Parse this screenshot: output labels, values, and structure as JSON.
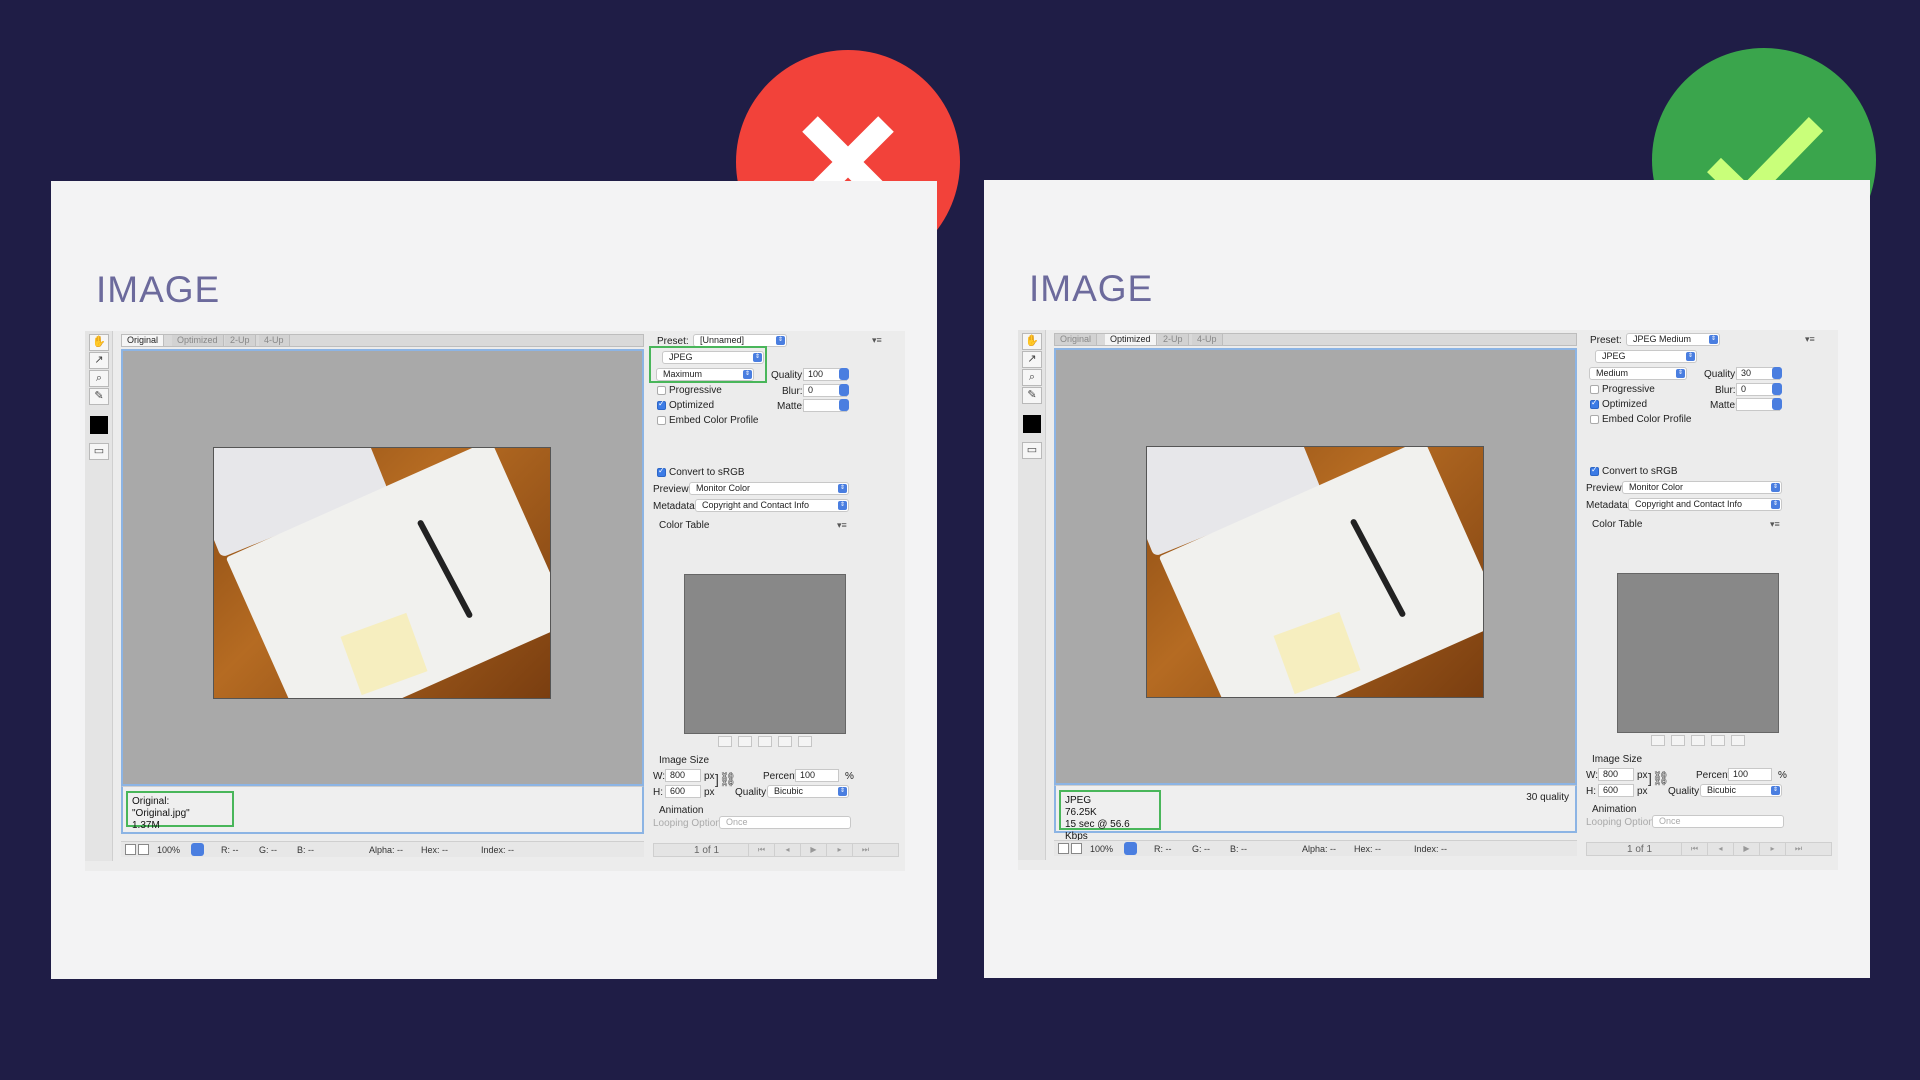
{
  "colors": {
    "background": "#1f1d46",
    "card": "#f3f3f4",
    "bad": "#f2423a",
    "good": "#3aa54c",
    "highlight": "#49b65a"
  },
  "cards": [
    {
      "heading": "IMAGE",
      "badge_icon": "cross-icon",
      "dialog": {
        "tabs": [
          "Original",
          "Optimized",
          "2-Up",
          "4-Up"
        ],
        "active_tab": "Original",
        "info_lines": [
          "Original: \"Original.jpg\"",
          "1.37M"
        ],
        "quality_note": "",
        "status": {
          "zoom": "100%",
          "r": "R: --",
          "g": "G: --",
          "b": "B: --",
          "alpha": "Alpha: --",
          "hex": "Hex: --",
          "index": "Index: --"
        },
        "preset_label": "Preset:",
        "preset_value": "[Unnamed]",
        "format": "JPEG",
        "quality_level": "Maximum",
        "quality_label": "Quality:",
        "quality_value": "100",
        "blur_label": "Blur:",
        "blur_value": "0",
        "matte_label": "Matte:",
        "matte_value": "",
        "progressive": "Progressive",
        "progressive_checked": false,
        "optimized": "Optimized",
        "optimized_checked": true,
        "embed": "Embed Color Profile",
        "embed_checked": false,
        "srgb": "Convert to sRGB",
        "srgb_checked": true,
        "preview_label": "Preview:",
        "preview_value": "Monitor Color",
        "metadata_label": "Metadata:",
        "metadata_value": "Copyright and Contact Info",
        "color_table": "Color Table",
        "image_size": "Image Size",
        "w_label": "W:",
        "w_value": "800",
        "h_label": "H:",
        "h_value": "600",
        "px": "px",
        "percent_label": "Percent:",
        "percent_value": "100",
        "percent_unit": "%",
        "resample_label": "Quality:",
        "resample_value": "Bicubic",
        "animation": "Animation",
        "looping_label": "Looping Options:",
        "looping_value": "Once",
        "frame": "1 of 1"
      }
    },
    {
      "heading": "IMAGE",
      "badge_icon": "checkmark-icon",
      "dialog": {
        "tabs": [
          "Original",
          "Optimized",
          "2-Up",
          "4-Up"
        ],
        "active_tab": "Optimized",
        "info_lines": [
          "JPEG",
          "76.25K",
          "15 sec @ 56.6 Kbps"
        ],
        "quality_note": "30 quality",
        "status": {
          "zoom": "100%",
          "r": "R: --",
          "g": "G: --",
          "b": "B: --",
          "alpha": "Alpha: --",
          "hex": "Hex: --",
          "index": "Index: --"
        },
        "preset_label": "Preset:",
        "preset_value": "JPEG Medium",
        "format": "JPEG",
        "quality_level": "Medium",
        "quality_label": "Quality:",
        "quality_value": "30",
        "blur_label": "Blur:",
        "blur_value": "0",
        "matte_label": "Matte:",
        "matte_value": "",
        "progressive": "Progressive",
        "progressive_checked": false,
        "optimized": "Optimized",
        "optimized_checked": true,
        "embed": "Embed Color Profile",
        "embed_checked": false,
        "srgb": "Convert to sRGB",
        "srgb_checked": true,
        "preview_label": "Preview:",
        "preview_value": "Monitor Color",
        "metadata_label": "Metadata:",
        "metadata_value": "Copyright and Contact Info",
        "color_table": "Color Table",
        "image_size": "Image Size",
        "w_label": "W:",
        "w_value": "800",
        "h_label": "H:",
        "h_value": "600",
        "px": "px",
        "percent_label": "Percent:",
        "percent_value": "100",
        "percent_unit": "%",
        "resample_label": "Quality:",
        "resample_value": "Bicubic",
        "animation": "Animation",
        "looping_label": "Looping Options:",
        "looping_value": "Once",
        "frame": "1 of 1"
      }
    }
  ]
}
